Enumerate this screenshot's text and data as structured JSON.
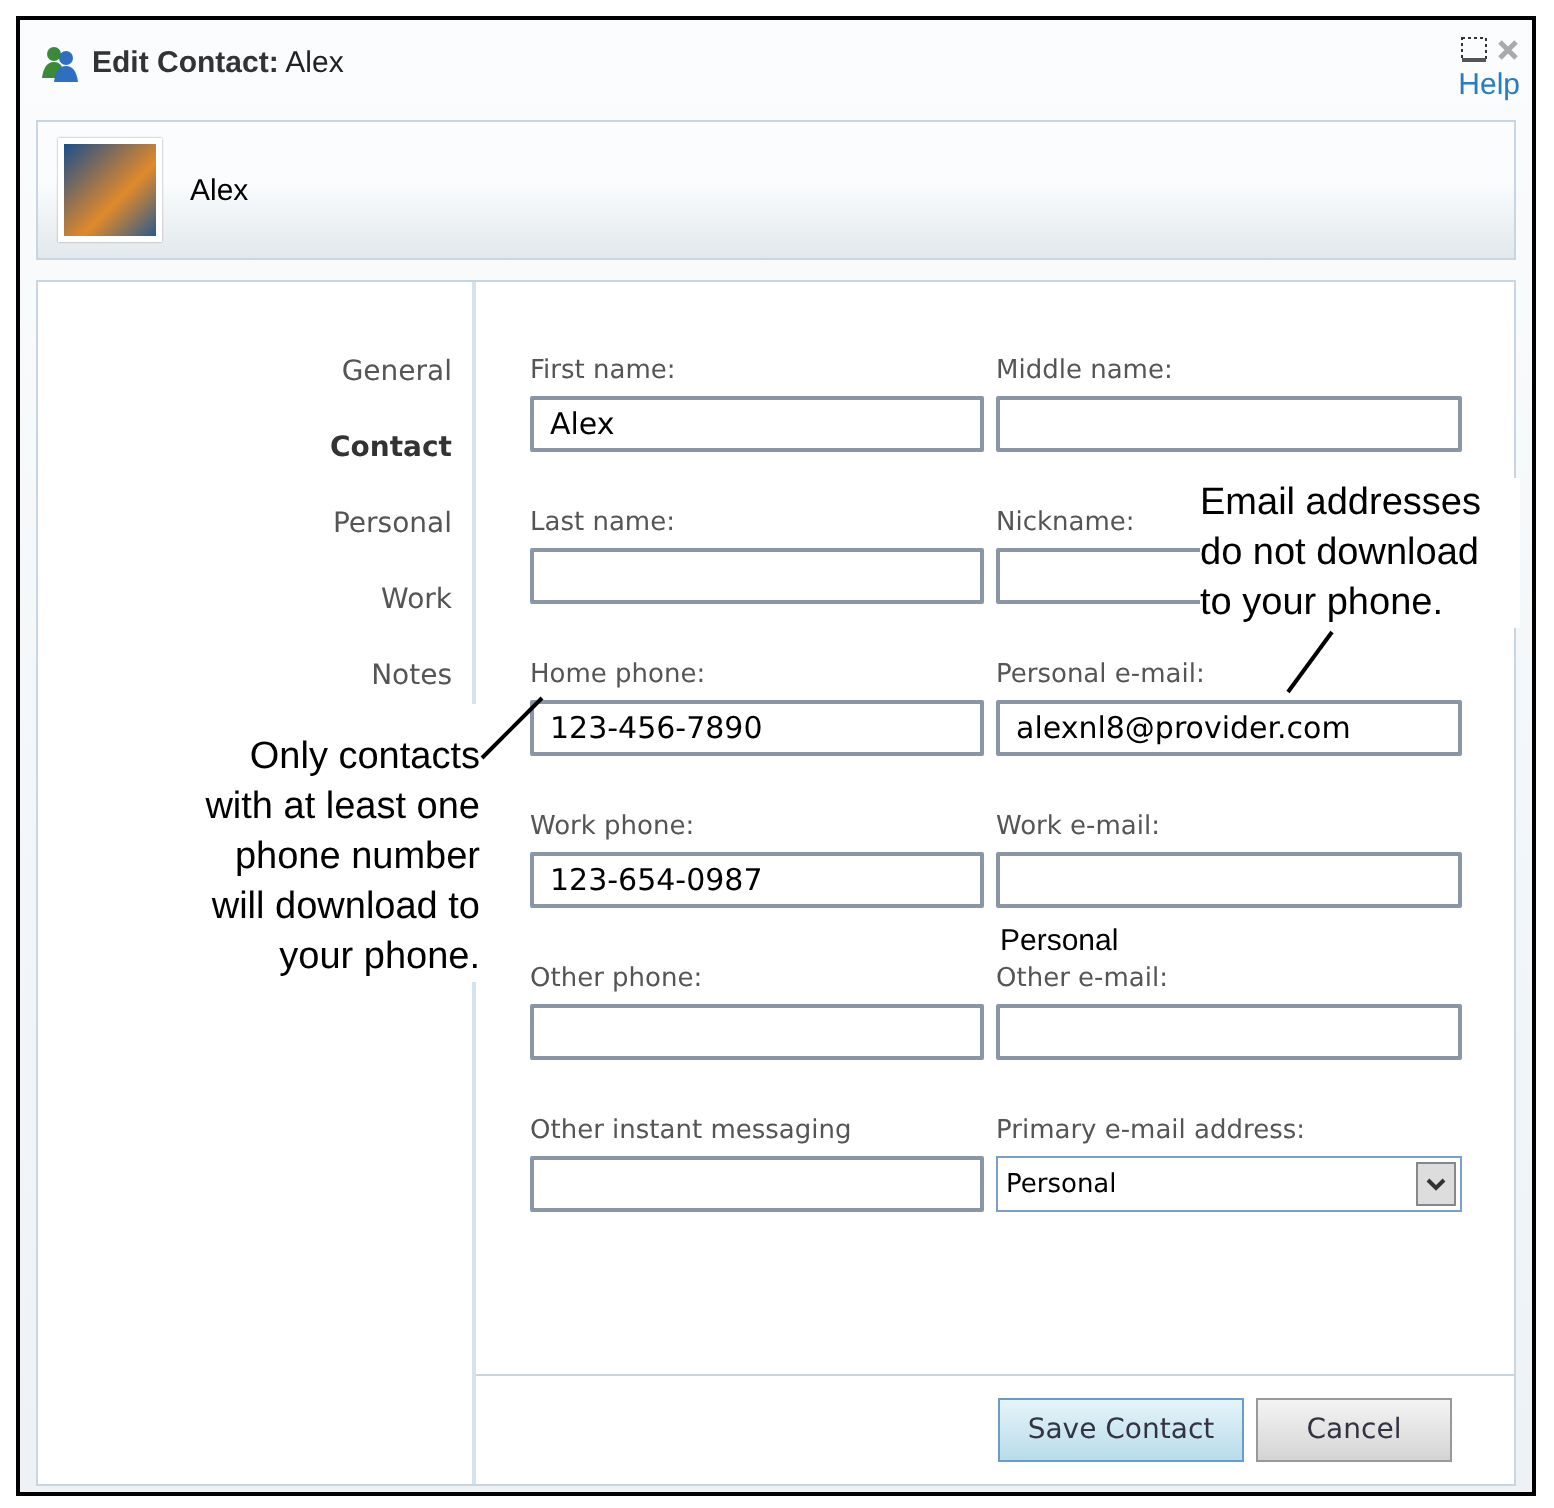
{
  "window": {
    "title": "**Edit Contact:** Alex",
    "help": "Help"
  },
  "header": {
    "name": "Alex"
  },
  "sidebar": {
    "items": [
      {
        "label": "General",
        "selected": false
      },
      {
        "label": "Contact",
        "selected": true
      },
      {
        "label": "Personal",
        "selected": false
      },
      {
        "label": "Work",
        "selected": false
      },
      {
        "label": "Notes",
        "selected": false
      }
    ]
  },
  "form": {
    "fields": [
      {
        "label": "First name:",
        "kind": "text",
        "value": "Alex"
      },
      {
        "label": "Middle name:",
        "kind": "text"
      },
      {
        "label": "Last name:",
        "kind": "text"
      },
      {
        "label": "Nickname:",
        "kind": "text"
      },
      {
        "label": "Home phone:",
        "kind": "text",
        "value": "123-456-7890"
      },
      {
        "label": "Personal e-mail:",
        "kind": "text",
        "value": "alexnl8@provider.com"
      },
      {
        "label": "Work phone:",
        "kind": "text",
        "value": "123-654-0987"
      },
      {
        "label": "Work e-mail:",
        "kind": "text"
      },
      {
        "label": "Other phone:",
        "kind": "text"
      },
      {
        "label": "Other e-mail:",
        "kind": "text"
      },
      {
        "label": "Other instant messaging",
        "kind": "text"
      },
      {
        "label": "Primary e-mail address:",
        "kind": "select",
        "value": "Personal"
      }
    ]
  },
  "buttons": [
    {
      "label": "Save Contact",
      "kind": "primary"
    },
    {
      "label": "Cancel",
      "kind": "normal"
    }
  ],
  "stray_label": "Personal",
  "callouts": [
    {
      "text": "Only contacts\nwith at least one\nphone number\nwill download to\nyour phone."
    },
    {
      "text": "Email addresses\ndo not download\nto your phone."
    }
  ]
}
